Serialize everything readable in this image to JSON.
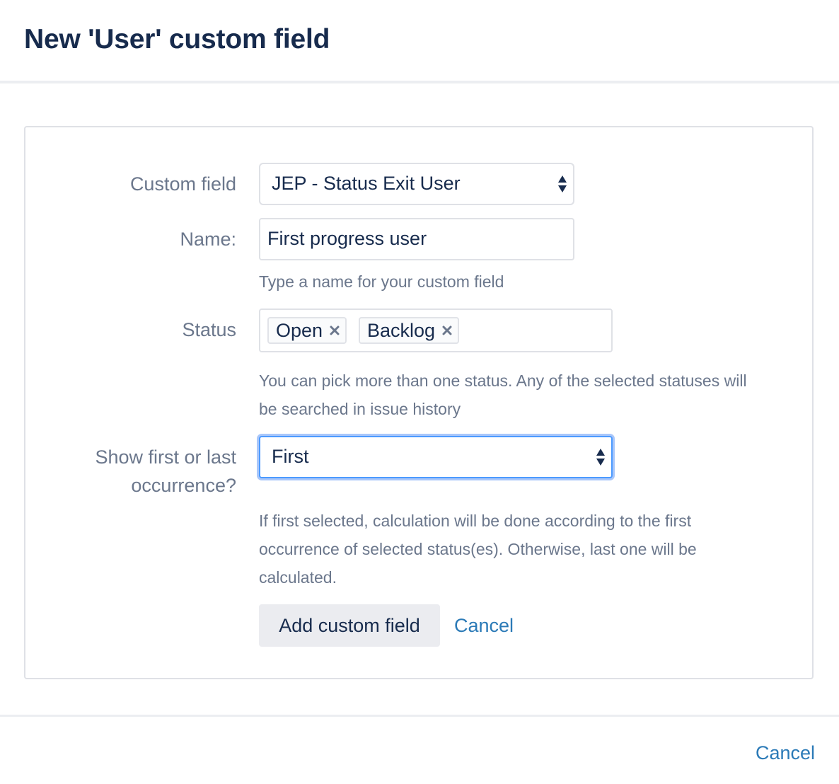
{
  "dialog": {
    "title": "New 'User' custom field"
  },
  "form": {
    "custom_field": {
      "label": "Custom field",
      "selected": "JEP - Status Exit User"
    },
    "name": {
      "label": "Name:",
      "value": "First progress user",
      "help": "Type a name for your custom field"
    },
    "status": {
      "label": "Status",
      "chips": [
        "Open",
        "Backlog"
      ],
      "help_line1": "You can pick more than one status. Any of the selected statuses will",
      "help_line2": "be searched in issue history"
    },
    "occurrence": {
      "label_line1": "Show first or last",
      "label_line2": "occurrence?",
      "selected": "First",
      "help_line1": "If first selected, calculation will be done according to the first",
      "help_line2": "occurrence of selected status(es). Otherwise, last one will be",
      "help_line3": "calculated."
    },
    "actions": {
      "add_label": "Add custom field",
      "cancel_label": "Cancel"
    }
  },
  "footer": {
    "cancel_label": "Cancel"
  },
  "colors": {
    "title": "#172b4d",
    "label": "#6b778c",
    "link": "#2b7ab7",
    "focus": "#4c9aff"
  }
}
